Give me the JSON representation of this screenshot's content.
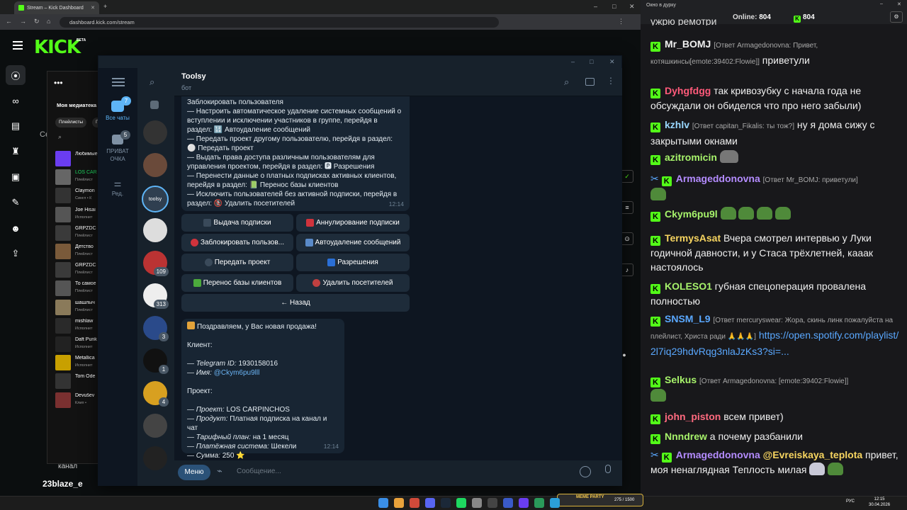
{
  "browser": {
    "tabs": [
      {
        "label": "Stream – Kick Dashboard"
      }
    ],
    "url": "dashboard.kick.com/stream",
    "window_controls": [
      "–",
      "□",
      "✕"
    ]
  },
  "kick": {
    "logo": "KICK",
    "logo_tag": "BETA",
    "sidebar_icons": [
      "broadcast-icon",
      "link-icon",
      "chart-icon",
      "trophy-icon",
      "layout-icon",
      "wrench-icon",
      "users-icon",
      "upload-icon"
    ],
    "bottom_labels": [
      "канал",
      "23blaze_e",
      "Се"
    ]
  },
  "media_library": {
    "title": "Моя медиатека",
    "filters": [
      "Плейлисты",
      "П"
    ],
    "items": [
      {
        "title": "Любимые",
        "sub": ""
      },
      {
        "title": "LOS CAR",
        "sub": "Плейлист"
      },
      {
        "title": "Claymon",
        "sub": "Сингл • К"
      },
      {
        "title": "Joe Hisai",
        "sub": "Исполнит"
      },
      {
        "title": "GRPZDC",
        "sub": "Плейлист"
      },
      {
        "title": "Детство",
        "sub": "Плейлист"
      },
      {
        "title": "GRPZDC",
        "sub": "Плейлист"
      },
      {
        "title": "То самое",
        "sub": "Плейлист"
      },
      {
        "title": "шашлыч",
        "sub": "Плейлист"
      },
      {
        "title": "mishlaw",
        "sub": "Исполнит"
      },
      {
        "title": "Daft Punk",
        "sub": "Исполнит"
      },
      {
        "title": "Metallica",
        "sub": "Исполнит"
      },
      {
        "title": "Tom Ode",
        "sub": ""
      },
      {
        "title": "Devušev",
        "sub": "Клип •"
      }
    ]
  },
  "telegram": {
    "chat_title": "Toolsy",
    "chat_subtitle": "бот",
    "folders": [
      {
        "label": "Все чаты",
        "badge": "7"
      },
      {
        "label": "ПРИВАТ\nОЧКА",
        "badge": "5"
      },
      {
        "label": "Ред.",
        "badge": ""
      }
    ],
    "chat_badges": [
      "",
      "",
      "",
      "",
      "",
      "109",
      "313",
      "3",
      "1",
      "4",
      "",
      ""
    ],
    "menu_lines": [
      "Заблокировать пользователя",
      "— Настроить автоматическое удаление системных сообщений о",
      "вступлении и исключении участников в группе, перейдя в",
      "раздел: 🔢 Автоудаление сообщений",
      "— Передать проект другому пользователю, перейдя в раздел:",
      "⚪ Передать проект",
      "— Выдать права доступа различным пользователям для",
      "управления проектом, перейдя в раздел: 🅿 Разрешения",
      "— Перенести данные о платных подписках активных клиентов,",
      "перейдя в раздел: 📗 Перенос базы клиентов",
      "— Исключить пользователей без активной подписки, перейдя в",
      "раздел: 🚷 Удалить посетителей"
    ],
    "menu_time": "12:14",
    "keyboard": [
      [
        "Выдача подписки",
        "Аннулирование подписки"
      ],
      [
        "Заблокировать пользов...",
        "Автоудаление сообщений"
      ],
      [
        "Передать проект",
        "Разрешения"
      ],
      [
        "Перенос базы клиентов",
        "Удалить посетителей"
      ],
      [
        "← Назад"
      ]
    ],
    "sale": {
      "headline": "Поздравляем, у Вас новая продажа!",
      "client_label": "Клиент:",
      "telegram_id_label": "— Telegram ID:",
      "telegram_id": "1930158016",
      "name_label": "— Имя:",
      "name": "@Ckym6pu9lll",
      "project_label": "Проект:",
      "project_line_label": "— Проект:",
      "project": "LOS CARPINCHOS",
      "product_label": "— Продукт:",
      "product": "Платная подписка на канал и чат",
      "plan_label": "— Тарифный план:",
      "plan": "на 1 месяц",
      "payment_label": "— Платёжная система:",
      "payment": "Шекели",
      "sum_label": "— Сумма:",
      "sum": "250 ⭐",
      "time": "12:14"
    },
    "menu_button": "Меню",
    "input_placeholder": "Сообщение..."
  },
  "chat": {
    "window_title": "Окно в дурку",
    "online_label": "Online:",
    "online_count": "804",
    "viewers": "804",
    "top_fragment": "ужрю ремотри",
    "messages": [
      {
        "user": "Mr_BOMJ",
        "color": "#f0f0f0",
        "reply": "[Ответ Armagedonovna: Привет, котяшкинсы[emote:39402:Flowie]]",
        "text": "приветули"
      },
      {
        "user": "Dyhgfdgg",
        "color": "#ff5a7a",
        "reply": "",
        "text": "так кривозубку с начала года не обсуждали он обиделся что про него забыли)"
      },
      {
        "user": "kzhlv",
        "color": "#9ad8ff",
        "reply": "[Ответ capitan_Fikalis: ты тож?]",
        "text": "ну я дома сижу с закрытыми окнами"
      },
      {
        "user": "azitromicin",
        "color": "#a7f36b",
        "reply": "",
        "text": ""
      },
      {
        "user": "Armageddonovna",
        "color": "#b48cff",
        "reply": "[Ответ Mr_BOMJ: приветули]",
        "text": ""
      },
      {
        "user": "Ckym6pu9l",
        "color": "#a7f36b",
        "reply": "",
        "text": ""
      },
      {
        "user": "TermysAsat",
        "color": "#f7d560",
        "reply": "",
        "text": "Вчера смотрел интервью у Луки годичной давности, и у Стаса трёхлетней, кааак настоялось"
      },
      {
        "user": "KOLESO1",
        "color": "#a7f36b",
        "reply": "",
        "text": "губная спецоперация провалена полностью"
      },
      {
        "user": "SNSM_L9",
        "color": "#5aa8ff",
        "reply": "[Ответ mercuryswear: Жора, скинь линк пожалуйста на плейлист, Христа ради 🙏🙏🙏]",
        "text": "https://open.spotify.com/playlist/2l7iq29hdvRqg3nlaJzKs3?si=..."
      },
      {
        "user": "Selkus",
        "color": "#a7f36b",
        "reply": "[Ответ Armagedonovna: [emote:39402:Flowie]]",
        "text": ""
      },
      {
        "user": "john_piston",
        "color": "#ff6a7f",
        "reply": "",
        "text": "всем привет)"
      },
      {
        "user": "Nnndrew",
        "color": "#a7f36b",
        "reply": "",
        "text": "а почему разбанили"
      },
      {
        "user": "Armageddonovna",
        "color": "#b48cff",
        "reply": "",
        "mention": "@Evreiskaya_teplota",
        "text": "привет, моя ненаглядная Теплость милая"
      }
    ]
  },
  "taskbar": {
    "lang": "РУС",
    "time": "12:15",
    "date": "30.04.2026",
    "meme_widget": "MEME PARTY",
    "meme_progress": "275 / 1500"
  }
}
